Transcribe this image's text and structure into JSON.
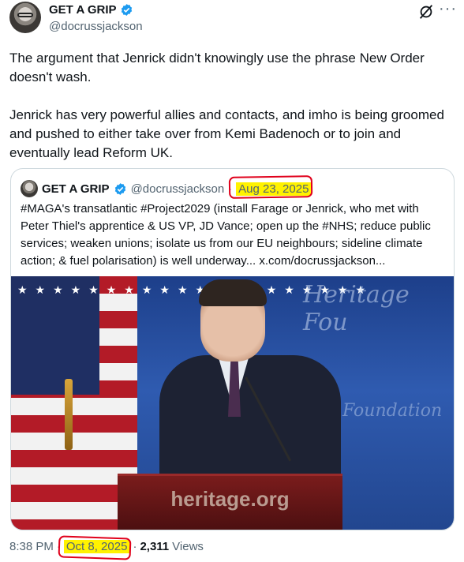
{
  "tweet": {
    "display_name": "GET A GRIP",
    "handle": "@docrussjackson",
    "more_glyph": "···",
    "body": "The argument that Jenrick didn't knowingly use the phrase New Order doesn't wash.\n\nJenrick has very powerful allies and contacts, and imho is being groomed and pushed to either take over from Kemi Badenoch or to join and eventually lead Reform UK."
  },
  "quote": {
    "display_name": "GET A GRIP",
    "handle": "@docrussjackson",
    "separator": "·",
    "date": "Aug 23, 2025",
    "text": "#MAGA's transatlantic #Project2029 (install Farage or Jenrick, who met with Peter Thiel's apprentice & US VP, JD Vance; open up the #NHS; reduce public services; weaken unions; isolate us from our EU neighbours; sideline climate action; & fuel polarisation) is well underway...  x.com/docrussjackson...",
    "media": {
      "backdrop_text_1": "Heritage Fou",
      "backdrop_text_2": "Foundation",
      "podium_text": "heritage.org"
    }
  },
  "meta": {
    "time": "8:38 PM",
    "separator": "·",
    "date": "Oct 8, 2025",
    "views_count": "2,311",
    "views_label": "Views"
  },
  "colors": {
    "highlight": "#fff200",
    "annotation_circle": "#e0001b",
    "verified_blue": "#1d9bf0"
  }
}
